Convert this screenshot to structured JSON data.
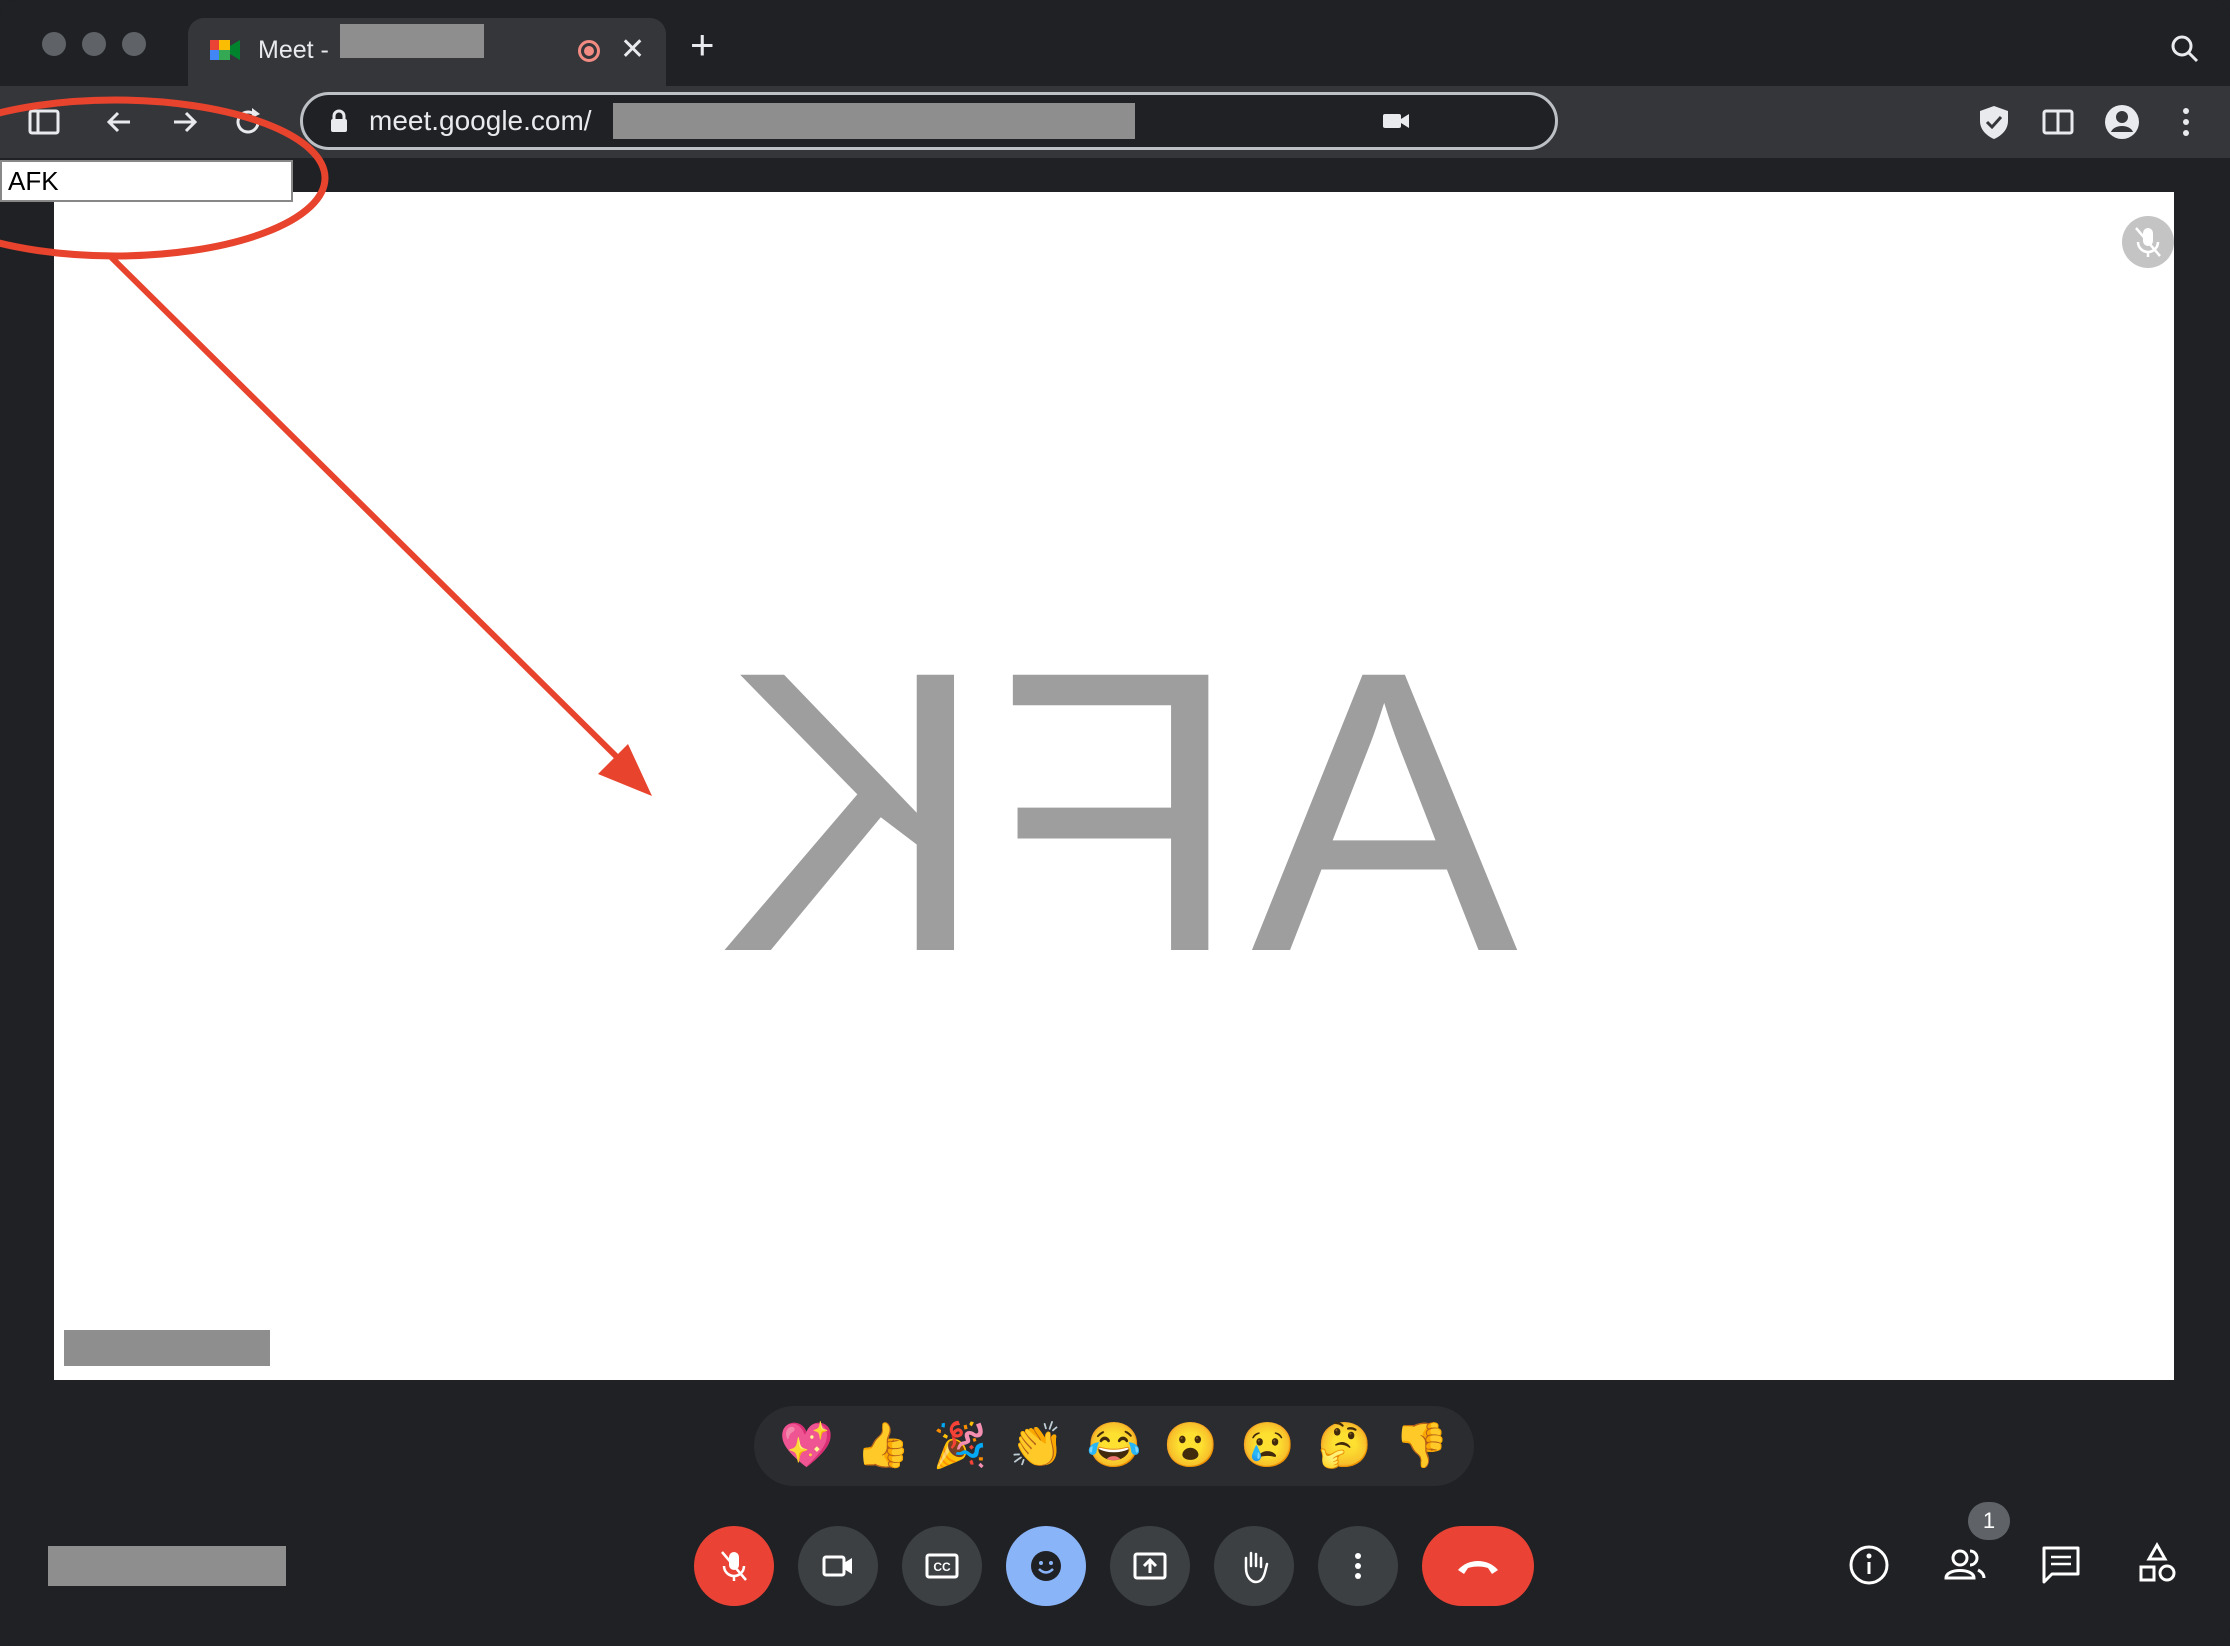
{
  "tab": {
    "title": "Meet -",
    "close_label": "✕",
    "new_tab_label": "+"
  },
  "address_bar": {
    "url": "meet.google.com/"
  },
  "overlay": {
    "afk_input_value": "AFK"
  },
  "stage": {
    "mirrored_text": "AFK"
  },
  "reactions": [
    "💖",
    "👍",
    "🎉",
    "👏",
    "😂",
    "😮",
    "😢",
    "🤔",
    "👎"
  ],
  "people_badge": "1",
  "colors": {
    "end_call": "#ea4335",
    "mute_active": "#ea4335",
    "reaction_active": "#8ab4f8",
    "annotation": "#e8432d"
  }
}
